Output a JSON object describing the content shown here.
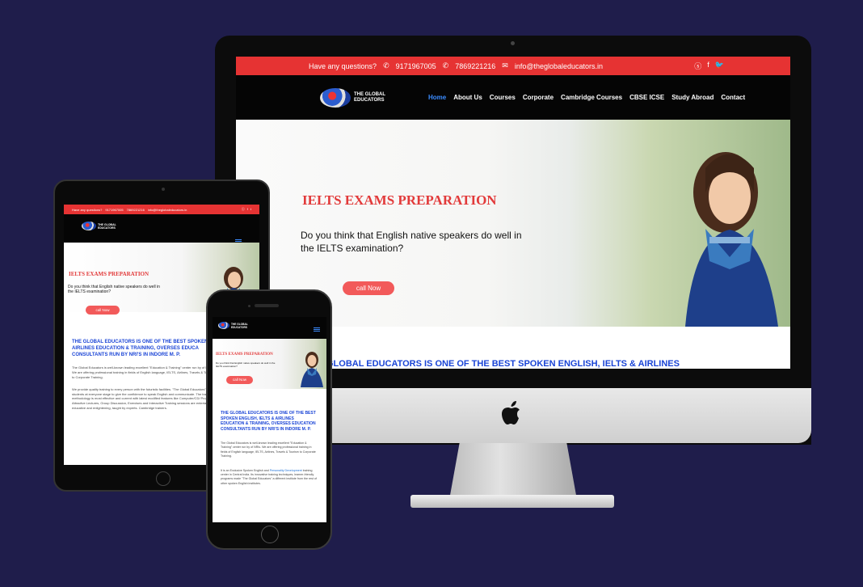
{
  "site": {
    "topbar": {
      "question": "Have any questions?",
      "phone1": "9171967005",
      "phone2": "7869221216",
      "email": "info@theglobaleducators.in",
      "social_icons": [
        "skype-icon",
        "facebook-icon",
        "twitter-icon"
      ]
    },
    "logo_line1": "THE GLOBAL",
    "logo_line2": "EDUCATORS",
    "menu": [
      "Home",
      "About Us",
      "Courses",
      "Corporate",
      "Cambridge Courses",
      "CBSE ICSE",
      "Study Abroad",
      "Contact"
    ],
    "hero": {
      "title": "IELTS EXAMS PREPARATION",
      "subtitle": "Do you think that English native speakers do well in the IELTS examination?",
      "button": "call Now"
    },
    "banner_text": "GLOBAL EDUCATORS IS ONE OF THE BEST SPOKEN ENGLISH, IELTS & AIRLINES",
    "heading": "THE GLOBAL EDUCATORS IS ONE OF THE BEST SPOKEN ENGLISH, IELTS & AIRLINES EDUCATION & TRAINING, OVERSES EDUCATION CONSULTANTS RUN BY NRI'S IN INDORE M. P.",
    "ipad_heading": "THE GLOBAL EDUCATORS IS ONE OF THE BEST SPOKEN & AIRLINES EDUCATION & TRAINING, OVERSES EDUCA CONSULTANTS RUN BY NRI'S IN INDORE M. P.",
    "para1": "The Global Educators is well-known leading excellent \"Education & Training\" center run by of NRIs. We are offering professional training in fields of English language, IELTS, Airlines, Travels & Tourism to Corporate Training.",
    "para2_start": "It is an Exclusive Spoken English and",
    "para2_link": "Personality Development",
    "para2_end": "training center in Central India. Its innovative training techniques, learner-friendly programs made \"The Global Educators\" a different institute from the rest of other spoken English institutes.",
    "para3": "We provide quality training to every person with the futuristic facilities. \"The Global Educators\" helps students at everyone stage to give the confidence to speak English and communicate. The training methodology is most effective and current with latest modified features like Computer/CD/ Projector Attractive Lectures, Group Discussion, Exercises and Interactive Training sessions are entertaining, educative and enlightening, taught by experts. Cambridge trainers."
  }
}
